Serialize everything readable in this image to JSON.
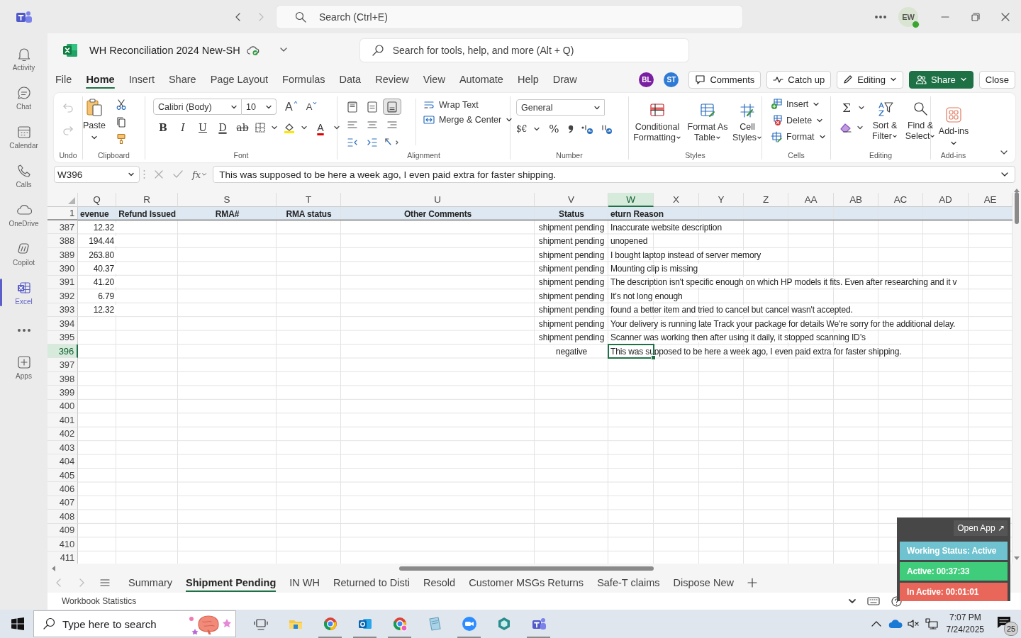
{
  "titlebar": {
    "search_placeholder": "Search (Ctrl+E)",
    "avatar": "EW"
  },
  "rail": [
    {
      "label": "Activity",
      "selected": false
    },
    {
      "label": "Chat",
      "selected": false
    },
    {
      "label": "Calendar",
      "selected": false
    },
    {
      "label": "Calls",
      "selected": false
    },
    {
      "label": "OneDrive",
      "selected": false
    },
    {
      "label": "Copilot",
      "selected": false
    },
    {
      "label": "Excel",
      "selected": true
    },
    {
      "label": "Apps",
      "selected": false
    }
  ],
  "workbook": {
    "title": "WH Reconciliation 2024 New-SH",
    "search_placeholder": "Search for tools, help, and more (Alt + Q)"
  },
  "menu_tabs": [
    {
      "label": "File",
      "selected": false
    },
    {
      "label": "Home",
      "selected": true
    },
    {
      "label": "Insert",
      "selected": false
    },
    {
      "label": "Share",
      "selected": false
    },
    {
      "label": "Page Layout",
      "selected": false
    },
    {
      "label": "Formulas",
      "selected": false
    },
    {
      "label": "Data",
      "selected": false
    },
    {
      "label": "Review",
      "selected": false
    },
    {
      "label": "View",
      "selected": false
    },
    {
      "label": "Automate",
      "selected": false
    },
    {
      "label": "Help",
      "selected": false
    },
    {
      "label": "Draw",
      "selected": false
    }
  ],
  "collaborators": [
    {
      "initials": "BL",
      "color": "#7b1fa2"
    },
    {
      "initials": "ST",
      "color": "#2f7ad6"
    }
  ],
  "header_buttons": {
    "comments": "Comments",
    "catch_up": "Catch up",
    "editing": "Editing",
    "share": "Share",
    "close": "Close"
  },
  "ribbon": {
    "undo": {
      "label": "Undo",
      "disabled": true
    },
    "clipboard": {
      "paste": "Paste",
      "label": "Clipboard"
    },
    "font": {
      "name": "Calibri (Body)",
      "size": "10",
      "grow": "A",
      "shrink": "A",
      "format_buttons": [
        "B",
        "I",
        "U",
        "D",
        "ab"
      ],
      "color_button": "A",
      "label": "Font"
    },
    "alignment": {
      "vertical": [
        {
          "selected": false
        },
        {
          "selected": false
        },
        {
          "selected": true
        }
      ],
      "wrap": "Wrap Text",
      "merge": "Merge & Center",
      "label": "Alignment"
    },
    "number": {
      "format": "General",
      "currency": "$€",
      "percent": "%",
      "label": "Number"
    },
    "styles": {
      "buttons": [
        "Conditional Formatting",
        "Format As Table",
        "Cell Styles"
      ],
      "label": "Styles"
    },
    "cells": {
      "buttons": [
        "Insert",
        "Delete",
        "Format"
      ],
      "label": "Cells"
    },
    "editing": {
      "sum": "Σ",
      "buttons": [
        "Sort & Filter",
        "Find & Select"
      ],
      "label": "Editing"
    },
    "addins": {
      "button": "Add-ins",
      "label": "Add-ins"
    }
  },
  "formula_bar": {
    "name_box": "W396",
    "fx": "fx",
    "content": "This was supposed to be here a week ago, I even paid extra for faster shipping."
  },
  "grid": {
    "columns": [
      {
        "label": "Q",
        "selected": false
      },
      {
        "label": "R",
        "selected": false
      },
      {
        "label": "S",
        "selected": false
      },
      {
        "label": "T",
        "selected": false
      },
      {
        "label": "U",
        "selected": false
      },
      {
        "label": "V",
        "selected": false
      },
      {
        "label": "W",
        "selected": true
      },
      {
        "label": "X",
        "selected": false
      },
      {
        "label": "Y",
        "selected": false
      },
      {
        "label": "Z",
        "selected": false
      },
      {
        "label": "AA",
        "selected": false
      },
      {
        "label": "AB",
        "selected": false
      },
      {
        "label": "AC",
        "selected": false
      },
      {
        "label": "AD",
        "selected": false
      },
      {
        "label": "AE",
        "selected": false
      }
    ],
    "header_row": {
      "number": "1",
      "q": "evenue",
      "r": "Refund Issued",
      "s": "RMA#",
      "t": "RMA status",
      "u": "Other Comments",
      "v": "Status",
      "w": "eturn Reason"
    },
    "rows": [
      {
        "number": "387",
        "selected": false,
        "q": "12.32",
        "v": "shipment pending",
        "w": "Inaccurate website description"
      },
      {
        "number": "388",
        "selected": false,
        "q": "194.44",
        "v": "shipment pending",
        "w": "unopened"
      },
      {
        "number": "389",
        "selected": false,
        "q": "263.80",
        "v": "shipment pending",
        "w": "I bought laptop instead of server memory"
      },
      {
        "number": "390",
        "selected": false,
        "q": "40.37",
        "v": "shipment pending",
        "w": "Mounting clip is missing"
      },
      {
        "number": "391",
        "selected": false,
        "q": "41.20",
        "v": "shipment pending",
        "w": "The description isn't specific enough on which HP models it fits. Even after researching and it v"
      },
      {
        "number": "392",
        "selected": false,
        "q": "6.79",
        "v": "shipment pending",
        "w": "It’s not long enough"
      },
      {
        "number": "393",
        "selected": false,
        "q": "12.32",
        "v": "shipment pending",
        "w": "found a better item and tried to cancel but cancel wasn't accepted."
      },
      {
        "number": "394",
        "selected": false,
        "v": "shipment pending",
        "w": "Your delivery is running late Track your package for details We're sorry for the additional delay."
      },
      {
        "number": "395",
        "selected": false,
        "v": "shipment pending",
        "w": "Scanner was working then after using it daily, it stopped scanning ID’s"
      },
      {
        "number": "396",
        "selected": true,
        "v": "negative",
        "w": "This was supposed to be here a week ago, I even paid extra for faster shipping."
      },
      {
        "number": "397",
        "selected": false
      },
      {
        "number": "398",
        "selected": false
      },
      {
        "number": "399",
        "selected": false
      },
      {
        "number": "400",
        "selected": false
      },
      {
        "number": "401",
        "selected": false
      },
      {
        "number": "402",
        "selected": false
      },
      {
        "number": "403",
        "selected": false
      },
      {
        "number": "404",
        "selected": false
      },
      {
        "number": "405",
        "selected": false
      },
      {
        "number": "406",
        "selected": false
      },
      {
        "number": "407",
        "selected": false
      },
      {
        "number": "408",
        "selected": false
      },
      {
        "number": "409",
        "selected": false
      },
      {
        "number": "410",
        "selected": false
      },
      {
        "number": "411",
        "selected": false
      }
    ]
  },
  "sheet_tabs": [
    {
      "label": "Summary",
      "selected": false
    },
    {
      "label": "Shipment Pending",
      "selected": true
    },
    {
      "label": "IN WH",
      "selected": false
    },
    {
      "label": "Returned to Disti",
      "selected": false
    },
    {
      "label": "Resold",
      "selected": false
    },
    {
      "label": "Customer MSGs Returns",
      "selected": false
    },
    {
      "label": "Safe-T claims",
      "selected": false
    },
    {
      "label": "Dispose New",
      "selected": false
    }
  ],
  "status_bar": {
    "text": "Workbook Statistics"
  },
  "widget": {
    "open_app": "Open App ↗",
    "rows": [
      {
        "label": "Working Status: Active",
        "color": "#6fc2cf"
      },
      {
        "label": "Active: 00:37:33",
        "color": "#3fcd7c"
      },
      {
        "label": "In Active: 00:01:01",
        "color": "#e9675a"
      }
    ]
  },
  "taskbar": {
    "search_placeholder": "Type here to search",
    "apps": [
      {
        "running": false
      },
      {
        "running": false
      },
      {
        "running": true
      },
      {
        "running": true
      },
      {
        "running": true
      },
      {
        "running": false
      },
      {
        "running": true
      },
      {
        "running": false
      },
      {
        "running": true
      }
    ],
    "time": "7:07 PM",
    "date": "7/24/2025",
    "notifications": "25"
  }
}
